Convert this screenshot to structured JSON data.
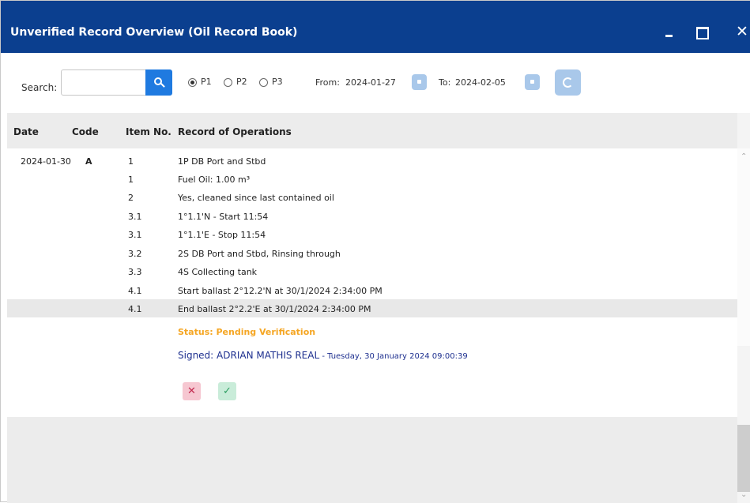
{
  "window": {
    "title": "Unverified Record Overview (Oil Record Book)",
    "close_glyph": "✕"
  },
  "toolbar": {
    "search_label": "Search:",
    "search_value": "",
    "search_placeholder": "",
    "priority_options": [
      {
        "label": "P1",
        "selected": true
      },
      {
        "label": "P2",
        "selected": false
      },
      {
        "label": "P3",
        "selected": false
      }
    ],
    "from_label": "From:",
    "from_date": "2024-01-27",
    "to_label": "To:",
    "to_date": "2024-02-05"
  },
  "grid": {
    "columns": [
      "Date",
      "Code",
      "Item No.",
      "Record of Operations"
    ],
    "record": {
      "date": "2024-01-30",
      "code": "A",
      "items": [
        {
          "item_no": "1",
          "operation": "1P DB Port and Stbd"
        },
        {
          "item_no": "1",
          "operation": "Fuel Oil: 1.00 m³"
        },
        {
          "item_no": "2",
          "operation": "Yes, cleaned since last contained oil"
        },
        {
          "item_no": "3.1",
          "operation": "1°1.1'N - Start 11:54"
        },
        {
          "item_no": "3.1",
          "operation": "1°1.1'E - Stop 11:54"
        },
        {
          "item_no": "3.2",
          "operation": "2S DB Port and Stbd, Rinsing through"
        },
        {
          "item_no": "3.3",
          "operation": "4S Collecting tank"
        },
        {
          "item_no": "4.1",
          "operation": "Start ballast 2°12.2'N at 30/1/2024 2:34:00 PM"
        },
        {
          "item_no": "4.1",
          "operation": "End ballast 2°2.2'E at 30/1/2024 2:34:00 PM"
        }
      ],
      "status": "Status: Pending Verification",
      "signed_by": "Signed: ADRIAN MATHIS REAL",
      "signed_date": " - Tuesday, 30 January 2024 09:00:39",
      "reject_glyph": "✕",
      "approve_glyph": "✓"
    }
  },
  "colors": {
    "titlebar": "#0b3f8f",
    "search_button": "#1f7ae0",
    "status": "#f5a623",
    "signed": "#1d2f8f",
    "reject": "#f6c7d1",
    "approve": "#c9ecd9"
  },
  "icons": {
    "search": "search-icon",
    "date_picker": "calendar-icon",
    "refresh": "refresh-icon",
    "minimize": "minimize-icon",
    "maximize": "maximize-icon",
    "close": "close-icon"
  }
}
